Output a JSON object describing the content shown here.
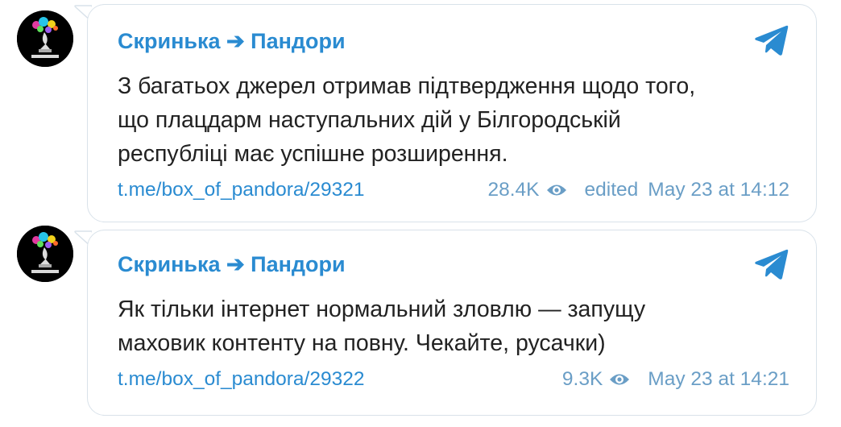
{
  "posts": [
    {
      "author": "Скринька ➔ Пандори",
      "lines": [
        "З багатьох джерел отримав підтвердження щодо того,",
        "що плацдарм наступальних дій у Білгородській",
        "республіці має успішне розширення."
      ],
      "link": "t.me/box_of_pandora/29321",
      "views": "28.4K",
      "edited": "edited",
      "date": "May 23 at 14:12"
    },
    {
      "author": "Скринька ➔ Пандори",
      "lines": [
        "Як тільки інтернет нормальний зловлю — запущу",
        "маховик контенту на повну. Чекайте, русачки)"
      ],
      "link": "t.me/box_of_pandora/29322",
      "views": "9.3K",
      "date": "May 23 at 14:21"
    }
  ],
  "colors": {
    "accent": "#2a8bd1",
    "meta": "#6a9ec6",
    "text": "#222222",
    "border": "#d9e2ea"
  },
  "icons": {
    "share": "telegram-plane-icon",
    "views": "eye-icon"
  }
}
